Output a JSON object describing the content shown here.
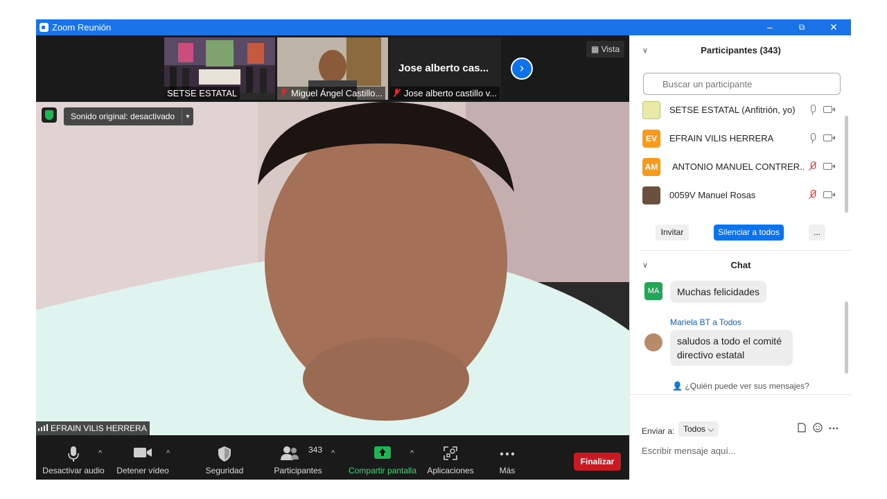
{
  "window": {
    "title": "Zoom Reunión",
    "minimize": "–",
    "restore": "⧉",
    "close": "✕"
  },
  "strip": {
    "thumbs": [
      {
        "caption": "SETSE ESTATAL",
        "muted": false
      },
      {
        "caption": "Miguel Ángel Castillo...",
        "muted": true
      },
      {
        "caption": "Jose alberto castillo v...",
        "muted": true,
        "name_overlay": "Jose alberto cas..."
      }
    ],
    "next_icon": "›",
    "view_label": "Vista"
  },
  "main_video": {
    "audio_pill": "Sonido original: desactivado",
    "speaker": "EFRAIN VILIS HERRERA"
  },
  "toolbar": {
    "mute": "Desactivar audio",
    "video": "Detener vídeo",
    "security": "Seguridad",
    "participants": "Participantes",
    "participants_count": "343",
    "share": "Compartir pantalla",
    "apps": "Aplicaciones",
    "more": "Más",
    "end": "Finalizar",
    "caret": "^"
  },
  "participants": {
    "title": "Participantes (343)",
    "search_placeholder": "Buscar un participante",
    "rows": [
      {
        "initials": "",
        "name": "SETSE ESTATAL (Anfitrión, yo)",
        "color": "#e9e9a8",
        "mic_off": false
      },
      {
        "initials": "EV",
        "name": "EFRAIN VILIS HERRERA",
        "color": "#f79a1e",
        "mic_off": false
      },
      {
        "initials": "AM",
        "name": "ANTONIO MANUEL CONTRER...",
        "color": "#f79a1e",
        "mic_off": true
      },
      {
        "initials": "",
        "name": "0059V Manuel Rosas",
        "color": "#6b5040",
        "mic_off": true
      }
    ],
    "invite": "Invitar",
    "mute_all": "Silenciar a todos",
    "more": "..."
  },
  "chat": {
    "title": "Chat",
    "messages": [
      {
        "avatar": "MA",
        "sender": "",
        "text": "Muchas felicidades"
      },
      {
        "avatar": "",
        "sender": "Mariela BT a Todos",
        "text": "saludos a todo el comité directivo estatal"
      }
    ],
    "who_can_see": "¿Quién puede ver sus mensajes?",
    "send_to_label": "Enviar a:",
    "send_to_value": "Todos",
    "compose_placeholder": "Escribir mensaje aquí..."
  },
  "colors": {
    "titlebar": "#1a73e8",
    "accent": "#0e72ed",
    "end": "#c81a22",
    "share": "#1fb552"
  }
}
